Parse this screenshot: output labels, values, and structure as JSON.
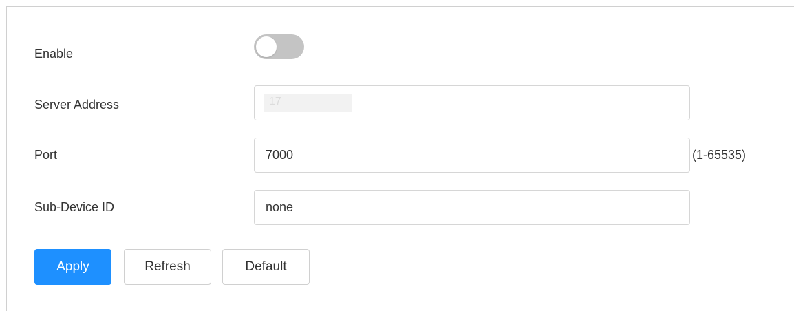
{
  "form": {
    "enable": {
      "label": "Enable",
      "state": "off"
    },
    "server_address": {
      "label": "Server Address",
      "value": "17"
    },
    "port": {
      "label": "Port",
      "value": "7000",
      "range_hint": "(1-65535)"
    },
    "sub_device_id": {
      "label": "Sub-Device ID",
      "value": "none"
    }
  },
  "buttons": {
    "apply_label": "Apply",
    "refresh_label": "Refresh",
    "default_label": "Default"
  },
  "colors": {
    "primary": "#1e90ff",
    "toggle_off": "#c4c4c4",
    "border": "#d6d6d6"
  }
}
